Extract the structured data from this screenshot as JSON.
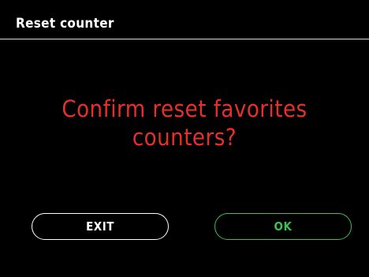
{
  "header": {
    "title": "Reset counter"
  },
  "dialog": {
    "message": "Confirm reset favorites counters?",
    "message_color": "#e8302a"
  },
  "buttons": {
    "exit_label": "EXIT",
    "ok_label": "OK",
    "exit_color": "#ffffff",
    "ok_color": "#3dbf54"
  },
  "theme": {
    "background": "#000000",
    "divider": "#d9d9d9"
  }
}
